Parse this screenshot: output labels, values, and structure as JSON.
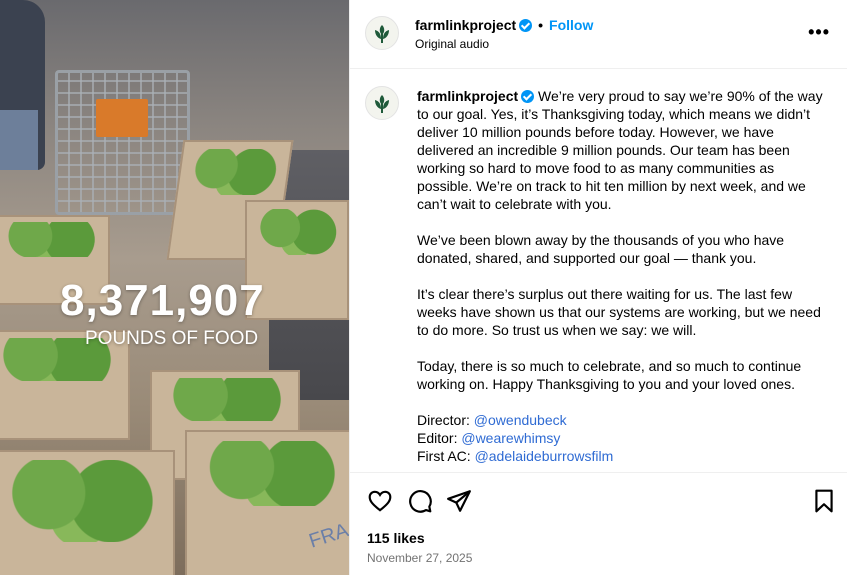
{
  "media": {
    "overlay_number": "8,371,907",
    "overlay_label": "POUNDS OF FOOD",
    "box_text": "FRA"
  },
  "header": {
    "username": "farmlinkproject",
    "dot": "•",
    "follow_label": "Follow",
    "audio_label": "Original audio",
    "more_label": "•••"
  },
  "caption": {
    "username": "farmlinkproject",
    "paragraphs": [
      "We’re very proud to say we’re 90% of the way to our goal. Yes, it’s Thanksgiving today, which means we didn’t deliver 10 million pounds before today. However, we have delivered an incredible 9 million pounds. Our team has been working so hard to move food to as many communities as possible. We’re on track to hit ten million by next week, and we can’t wait to celebrate with you.",
      "We’ve been blown away by the thousands of you who have donated, shared, and supported our goal — thank you.",
      "It’s clear there’s surplus out there waiting for us. The last few weeks have shown us that our systems are working, but we need to do more. So trust us when we say: we will.",
      "Today, there is so much to celebrate, and so much to continue working on. Happy Thanksgiving to you and your loved ones."
    ],
    "credits": [
      {
        "role": "Director:",
        "handle": "@owendubeck"
      },
      {
        "role": "Editor:",
        "handle": "@wearewhimsy"
      },
      {
        "role": "First AC:",
        "handle": "@adelaideburrowsfilm"
      }
    ]
  },
  "actions": {
    "icons": [
      "heart-icon",
      "comment-icon",
      "share-icon",
      "bookmark-icon"
    ],
    "likes": "115 likes",
    "date": "November 27, 2025"
  },
  "colors": {
    "accent": "#0095f6",
    "link": "#2f6bd3",
    "logo_green": "#1f5a3a"
  }
}
